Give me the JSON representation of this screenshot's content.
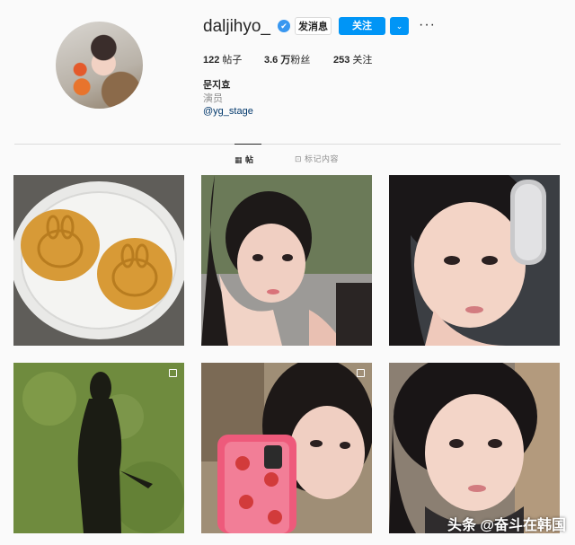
{
  "profile": {
    "username": "daljihyo_",
    "verified_symbol": "✔",
    "buttons": {
      "message": "发消息",
      "follow": "关注",
      "dropdown": "⌄",
      "more": "···"
    },
    "stats": {
      "posts": "122",
      "posts_label": "帖子",
      "followers": "3.6 万",
      "followers_label": "粉丝",
      "following": "253",
      "following_label": "关注"
    },
    "name": "문지효",
    "role": "演员",
    "link": "@yg_stage"
  },
  "tabs": [
    {
      "label": "帖子",
      "icon": "grid-icon",
      "glyph": "▦"
    },
    {
      "label": "标记内容",
      "icon": "tag-icon",
      "glyph": "⊡"
    }
  ],
  "watermark": "头条 @奋斗在韩国",
  "colors": {
    "accent": "#0095f6",
    "verified": "#3897f0",
    "background": "#fafafa"
  }
}
